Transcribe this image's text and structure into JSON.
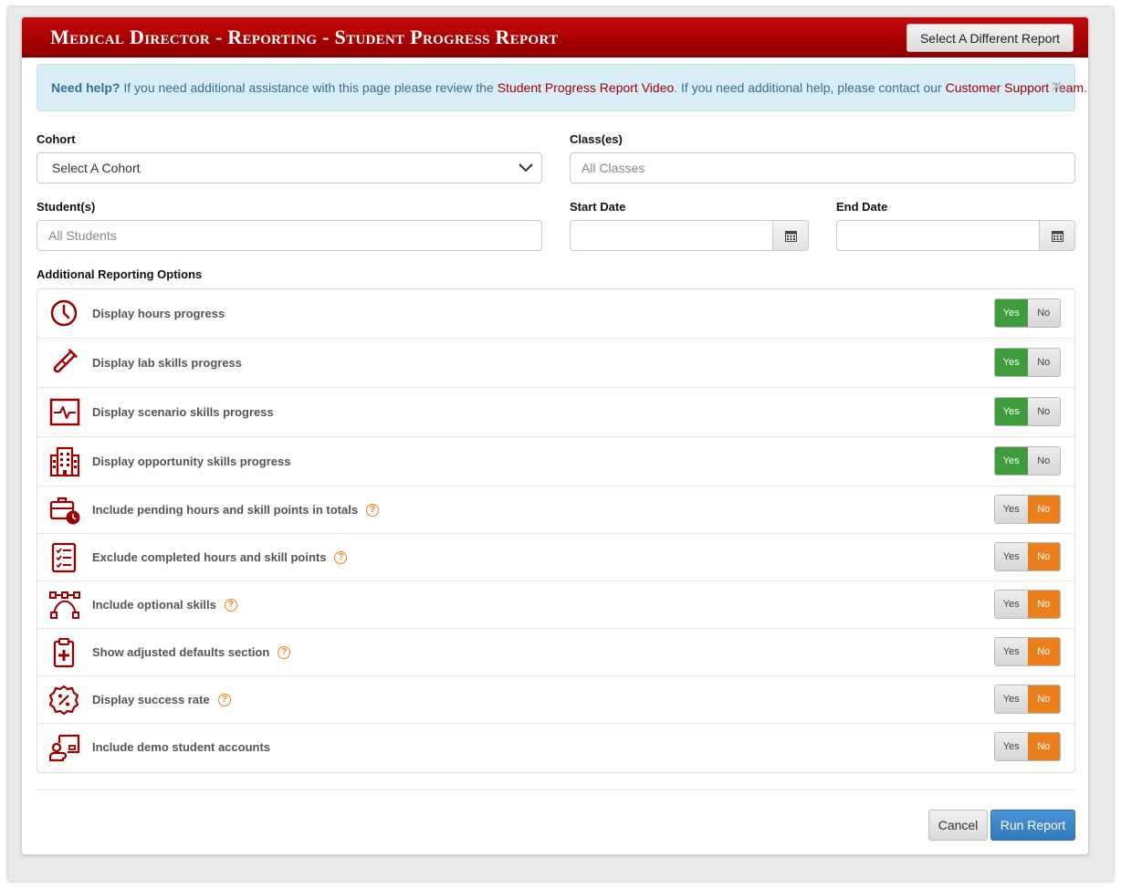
{
  "header": {
    "title": "Medical Director - Reporting - Student Progress Report",
    "select_report_label": "Select A Different Report"
  },
  "alert": {
    "lead": "Need help?",
    "text1": " If you need additional assistance with this page please review the ",
    "link1": "Student Progress Report Video",
    "text2": ". If you need additional help, please contact our ",
    "link2": "Customer Support Team",
    "text3": ".",
    "close": "×"
  },
  "form": {
    "cohort_label": "Cohort",
    "cohort_value": "Select A Cohort",
    "classes_label": "Class(es)",
    "classes_placeholder": "All Classes",
    "students_label": "Student(s)",
    "students_placeholder": "All Students",
    "start_date_label": "Start Date",
    "end_date_label": "End Date"
  },
  "options_heading": "Additional Reporting Options",
  "options": [
    {
      "label": "Display hours progress",
      "icon": "clock-icon",
      "value": "Yes",
      "help": false
    },
    {
      "label": "Display lab skills progress",
      "icon": "test-tube-icon",
      "value": "Yes",
      "help": false
    },
    {
      "label": "Display scenario skills progress",
      "icon": "heart-monitor-icon",
      "value": "Yes",
      "help": false
    },
    {
      "label": "Display opportunity skills progress",
      "icon": "hospital-building-icon",
      "value": "Yes",
      "help": false
    },
    {
      "label": "Include pending hours and skill points in totals",
      "icon": "briefcase-clock-icon",
      "value": "No",
      "help": true
    },
    {
      "label": "Exclude completed hours and skill points",
      "icon": "checklist-icon",
      "value": "No",
      "help": true
    },
    {
      "label": "Include optional skills",
      "icon": "bezier-path-icon",
      "value": "No",
      "help": true
    },
    {
      "label": "Show adjusted defaults section",
      "icon": "clipboard-plus-icon",
      "value": "No",
      "help": true
    },
    {
      "label": "Display success rate",
      "icon": "percent-badge-icon",
      "value": "No",
      "help": true
    },
    {
      "label": "Include demo student accounts",
      "icon": "chalkboard-user-icon",
      "value": "No",
      "help": false
    }
  ],
  "toggle_labels": {
    "yes": "Yes",
    "no": "No"
  },
  "help_glyph": "?",
  "footer": {
    "cancel_label": "Cancel",
    "run_label": "Run Report"
  },
  "colors": {
    "brand_red": "#a80000",
    "yes_green": "#3e9c3e",
    "no_orange": "#ea7f1c",
    "primary_blue": "#3379bd",
    "icon_red": "#9b0000"
  }
}
